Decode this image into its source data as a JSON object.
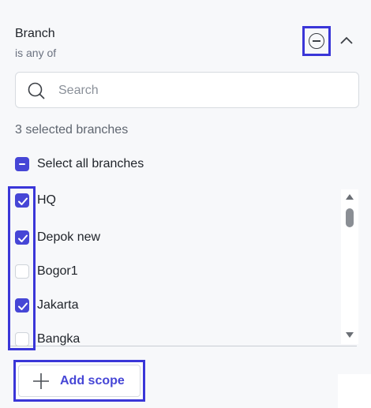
{
  "filter": {
    "title": "Branch",
    "subtitle": "is any of"
  },
  "search": {
    "placeholder": "Search",
    "value": ""
  },
  "selection": {
    "count_label": "3 selected branches",
    "select_all_label": "Select all branches",
    "select_all_state": "indeterminate"
  },
  "branches": [
    {
      "label": "HQ",
      "checked": true
    },
    {
      "label": "Depok new",
      "checked": true
    },
    {
      "label": "Bogor1",
      "checked": false
    },
    {
      "label": "Jakarta",
      "checked": true
    },
    {
      "label": "Bangka",
      "checked": false
    }
  ],
  "actions": {
    "add_scope_label": "Add scope"
  },
  "colors": {
    "accent": "#4646d6",
    "highlight": "#3a36d8"
  },
  "icons": {
    "remove": "minus-circle-icon",
    "collapse": "chevron-up-icon",
    "search": "search-icon",
    "add": "plus-icon"
  }
}
